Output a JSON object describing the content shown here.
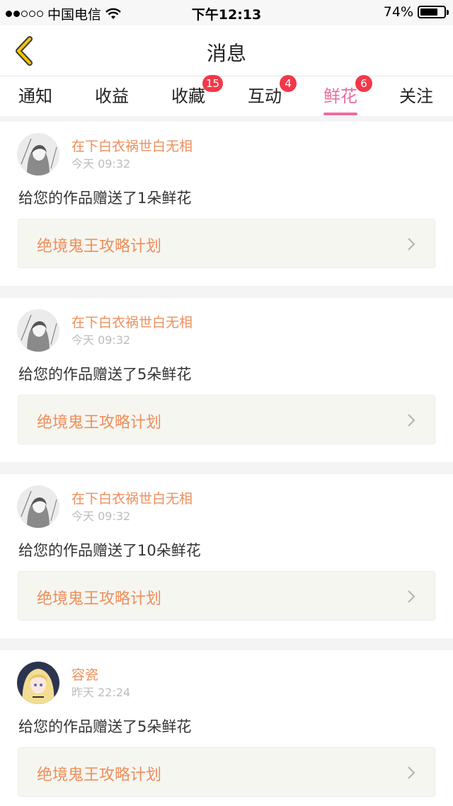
{
  "status_bar": {
    "carrier": "中国电信",
    "time": "下午12:13",
    "battery_percent": "74%",
    "battery_level": 0.74,
    "signal_bars": 2,
    "icons": [
      "signal-dots-icon",
      "wifi-icon",
      "battery-icon"
    ]
  },
  "nav": {
    "title": "消息",
    "back_icon": "chevron-left-icon",
    "accent_color": "#f5c400"
  },
  "tabs": [
    {
      "label": "通知",
      "badge": ""
    },
    {
      "label": "收益",
      "badge": ""
    },
    {
      "label": "收藏",
      "badge": "15"
    },
    {
      "label": "互动",
      "badge": "4"
    },
    {
      "label": "鲜花",
      "badge": "6",
      "active": true
    },
    {
      "label": "关注",
      "badge": ""
    }
  ],
  "colors": {
    "active_tab": "#ef6b9f",
    "badge": "#f2384a",
    "sender_name": "#ef8e5a",
    "work_title": "#ef8e5a"
  },
  "messages": [
    {
      "sender": "在下白衣祸世白无相",
      "time": "今天 09:32",
      "text": "给您的作品赠送了1朵鲜花",
      "work": "绝境鬼王攻略计划",
      "avatar": "sketch-avatar"
    },
    {
      "sender": "在下白衣祸世白无相",
      "time": "今天 09:32",
      "text": "给您的作品赠送了5朵鲜花",
      "work": "绝境鬼王攻略计划",
      "avatar": "sketch-avatar"
    },
    {
      "sender": "在下白衣祸世白无相",
      "time": "今天 09:32",
      "text": "给您的作品赠送了10朵鲜花",
      "work": "绝境鬼王攻略计划",
      "avatar": "sketch-avatar"
    },
    {
      "sender": "容瓷",
      "time": "昨天 22:24",
      "text": "给您的作品赠送了5朵鲜花",
      "work": "绝境鬼王攻略计划",
      "avatar": "blonde-anime-avatar"
    }
  ]
}
